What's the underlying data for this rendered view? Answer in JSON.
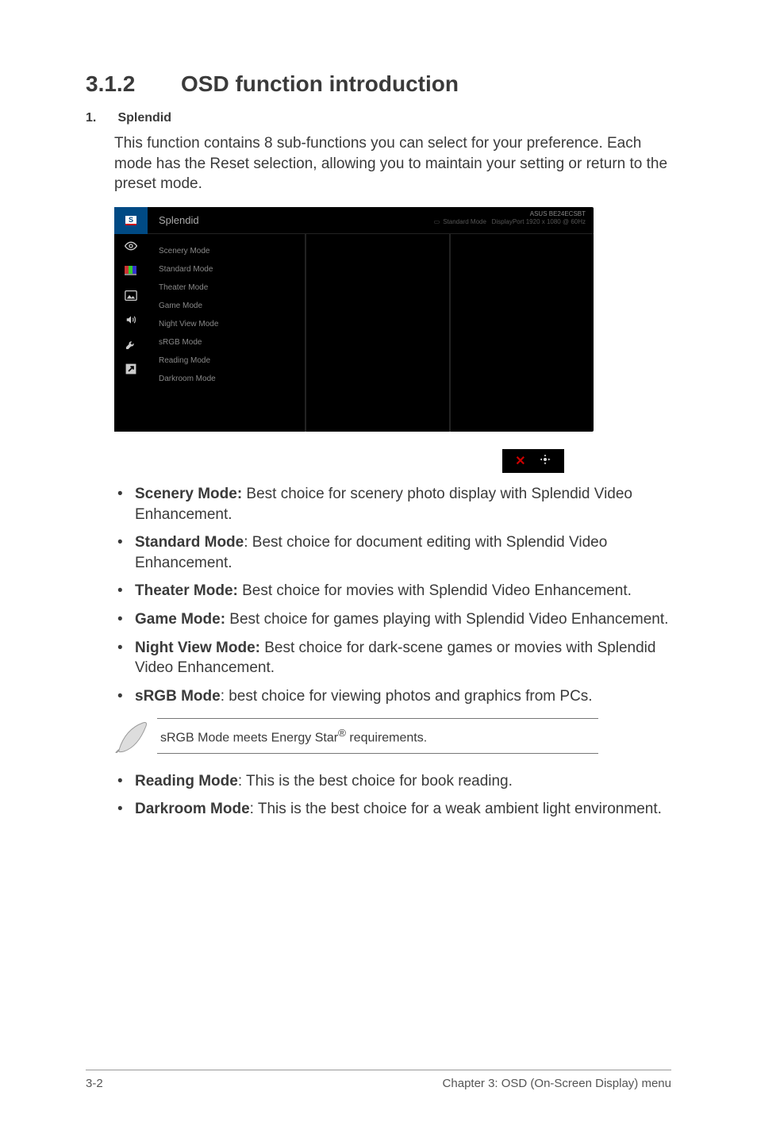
{
  "heading": {
    "num": "3.1.2",
    "title": "OSD function introduction"
  },
  "section": {
    "num": "1.",
    "label": "Splendid",
    "intro": "This function contains 8 sub-functions you can select for your preference. Each mode has the Reset selection, allowing you to maintain your setting or return to the preset mode."
  },
  "osd": {
    "title": "Splendid",
    "model": "ASUS BE24ECSBT",
    "mode": "Standard Mode",
    "res": "DisplayPort 1920 x 1080 @ 60Hz",
    "items": [
      "Scenery Mode",
      "Standard Mode",
      "Theater Mode",
      "Game Mode",
      "Night View Mode",
      "sRGB Mode",
      "Reading Mode",
      "Darkroom Mode"
    ]
  },
  "bullets_a": [
    {
      "b": "Scenery Mode:",
      "t": " Best choice for scenery photo display with Splendid Video Enhancement."
    },
    {
      "b": "Standard Mode",
      "t": ": Best choice for document editing with Splendid Video Enhancement."
    },
    {
      "b": "Theater Mode:",
      "t": " Best choice for movies with Splendid Video Enhancement."
    },
    {
      "b": "Game Mode:",
      "t": " Best choice for games playing with Splendid Video Enhancement."
    },
    {
      "b": "Night View Mode:",
      "t": " Best choice for dark-scene games or movies with Splendid Video Enhancement."
    },
    {
      "b": "sRGB Mode",
      "t": ": best choice for viewing photos and graphics from PCs."
    }
  ],
  "note": {
    "pre": "sRGB Mode meets Energy Star",
    "sup": "®",
    "post": " requirements."
  },
  "bullets_b": [
    {
      "b": "Reading Mode",
      "t": ": This is the best choice for book reading."
    },
    {
      "b": "Darkroom Mode",
      "t": ": This is the best choice for a weak ambient light environment."
    }
  ],
  "footer": {
    "left": "3-2",
    "right": "Chapter 3: OSD (On-Screen Display) menu"
  }
}
